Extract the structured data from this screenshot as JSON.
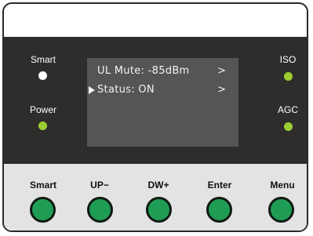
{
  "indicators": {
    "smart": {
      "label": "Smart",
      "led_color": "#ffffff"
    },
    "power": {
      "label": "Power",
      "led_color": "#9acd32"
    },
    "iso": {
      "label": "ISO",
      "led_color": "#9acd32"
    },
    "agc": {
      "label": "AGC",
      "led_color": "#9acd32"
    }
  },
  "screen": {
    "line1": {
      "text": "UL Mute: -85dBm",
      "arrow": ">"
    },
    "line2": {
      "text": "Status: ON",
      "arrow": ">",
      "selected": true
    }
  },
  "buttons": [
    {
      "label": "Smart"
    },
    {
      "label": "UP−"
    },
    {
      "label": "DW+"
    },
    {
      "label": "Enter"
    },
    {
      "label": "Menu"
    }
  ],
  "colors": {
    "panel": "#2f2c2c",
    "keypad": "#e3e3e3",
    "screen": "#555555",
    "button_fill": "#1f9d55",
    "button_border": "#0e1a12"
  }
}
